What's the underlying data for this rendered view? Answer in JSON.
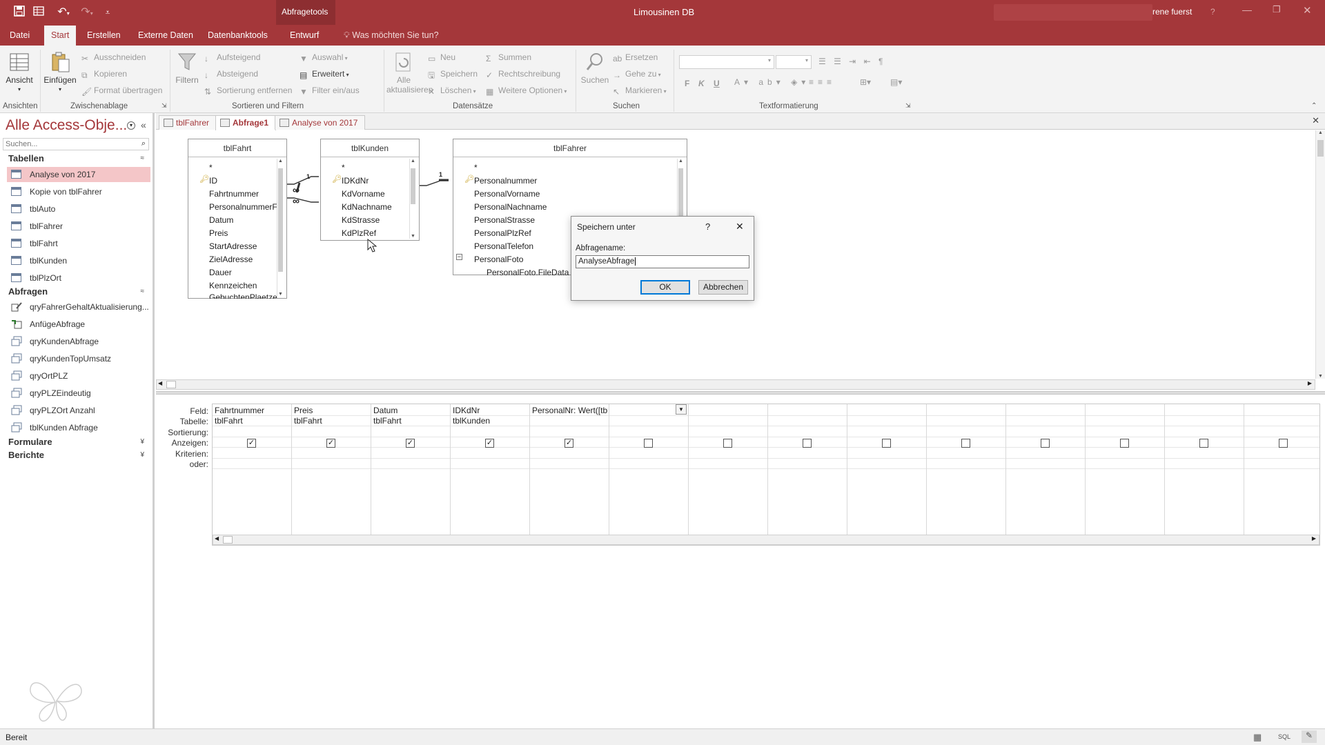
{
  "title_bar": {
    "context_tab": "Abfragetools",
    "app_title": "Limousinen DB",
    "user": "rene fuerst",
    "help": "?"
  },
  "ribbon_tabs": [
    "Datei",
    "Start",
    "Erstellen",
    "Externe Daten",
    "Datenbanktools",
    "Entwurf"
  ],
  "tell_me": "Was möchten Sie tun?",
  "ribbon": {
    "ansicht": "Ansicht",
    "einfuegen": "Einfügen",
    "ausschneiden": "Ausschneiden",
    "kopieren": "Kopieren",
    "format_uebertragen": "Format übertragen",
    "zwischenablage": "Zwischenablage",
    "ansichten": "Ansichten",
    "filtern": "Filtern",
    "aufsteigend": "Aufsteigend",
    "absteigend": "Absteigend",
    "sortierung_entfernen": "Sortierung entfernen",
    "auswahl": "Auswahl",
    "erweitert": "Erweitert",
    "filter_ein_aus": "Filter ein/aus",
    "sortieren_filtern": "Sortieren und Filtern",
    "alle": "Alle",
    "aktualisieren": "aktualisieren",
    "neu": "Neu",
    "speichern": "Speichern",
    "loeschen": "Löschen",
    "summen": "Summen",
    "rechtschreibung": "Rechtschreibung",
    "weitere_optionen": "Weitere Optionen",
    "datensaetze": "Datensätze",
    "suchen": "Suchen",
    "ersetzen": "Ersetzen",
    "gehe_zu": "Gehe zu",
    "markieren": "Markieren",
    "suchen_group": "Suchen",
    "textformatierung": "Textformatierung",
    "bold": "F",
    "italic": "K",
    "underline": "U"
  },
  "nav": {
    "header": "Alle Access-Obje...",
    "search_placeholder": "Suchen...",
    "sections": [
      {
        "name": "Tabellen",
        "chevron": "≈",
        "items": [
          "Analyse von 2017",
          "Kopie von tblFahrer",
          "tblAuto",
          "tblFahrer",
          "tblFahrt",
          "tblKunden",
          "tblPlzOrt"
        ]
      },
      {
        "name": "Abfragen",
        "chevron": "≈",
        "items": [
          "qryFahrerGehaltAktualisierung...",
          "AnfügeAbfrage",
          "qryKundenAbfrage",
          "qryKundenTopUmsatz",
          "qryOrtPLZ",
          "qryPLZEindeutig",
          "qryPLZOrt Anzahl",
          "tblKunden Abfrage"
        ]
      },
      {
        "name": "Formulare",
        "chevron": "¥"
      },
      {
        "name": "Berichte",
        "chevron": "¥"
      }
    ]
  },
  "doc_tabs": [
    "tblFahrer",
    "Abfrage1",
    "Analyse von 2017"
  ],
  "tables": [
    {
      "name": "tblFahrt",
      "fields": [
        "*",
        "ID",
        "Fahrtnummer",
        "PersonalnummerF",
        "Datum",
        "Preis",
        "StartAdresse",
        "ZielAdresse",
        "Dauer",
        "Kennzeichen",
        "GebuchtenPlaetze"
      ]
    },
    {
      "name": "tblKunden",
      "fields": [
        "*",
        "IDKdNr",
        "KdVorname",
        "KdNachname",
        "KdStrasse",
        "KdPlzRef"
      ]
    },
    {
      "name": "tblFahrer",
      "fields": [
        "*",
        "Personalnummer",
        "PersonalVorname",
        "PersonalNachname",
        "PersonalStrasse",
        "PersonalPlzRef",
        "PersonalTelefon",
        "PersonalFoto",
        "PersonalFoto.FileData"
      ]
    }
  ],
  "relations": {
    "one": "1",
    "many": "∞"
  },
  "dialog": {
    "title": "Speichern unter",
    "help": "?",
    "label": "Abfragename:",
    "value": "AnalyseAbfrage",
    "ok": "OK",
    "cancel": "Abbrechen"
  },
  "grid": {
    "row_labels": [
      "Feld:",
      "Tabelle:",
      "Sortierung:",
      "Anzeigen:",
      "Kriterien:",
      "oder:"
    ],
    "columns": [
      {
        "feld": "Fahrtnummer",
        "tabelle": "tblFahrt",
        "anzeigen": true
      },
      {
        "feld": "Preis",
        "tabelle": "tblFahrt",
        "anzeigen": true
      },
      {
        "feld": "Datum",
        "tabelle": "tblFahrt",
        "anzeigen": true
      },
      {
        "feld": "IDKdNr",
        "tabelle": "tblKunden",
        "anzeigen": true
      },
      {
        "feld": "PersonalNr: Wert([tblF",
        "tabelle": "",
        "anzeigen": true
      },
      {
        "feld": "",
        "tabelle": "",
        "anzeigen": false
      },
      {
        "feld": "",
        "tabelle": "",
        "anzeigen": false
      },
      {
        "feld": "",
        "tabelle": "",
        "anzeigen": false
      },
      {
        "feld": "",
        "tabelle": "",
        "anzeigen": false
      },
      {
        "feld": "",
        "tabelle": "",
        "anzeigen": false
      },
      {
        "feld": "",
        "tabelle": "",
        "anzeigen": false
      },
      {
        "feld": "",
        "tabelle": "",
        "anzeigen": false
      },
      {
        "feld": "",
        "tabelle": "",
        "anzeigen": false
      },
      {
        "feld": "",
        "tabelle": "",
        "anzeigen": false
      }
    ]
  },
  "status": {
    "text": "Bereit",
    "sql": "SQL"
  },
  "colors": {
    "accent": "#a4373a",
    "selected": "#f4c6c8"
  }
}
